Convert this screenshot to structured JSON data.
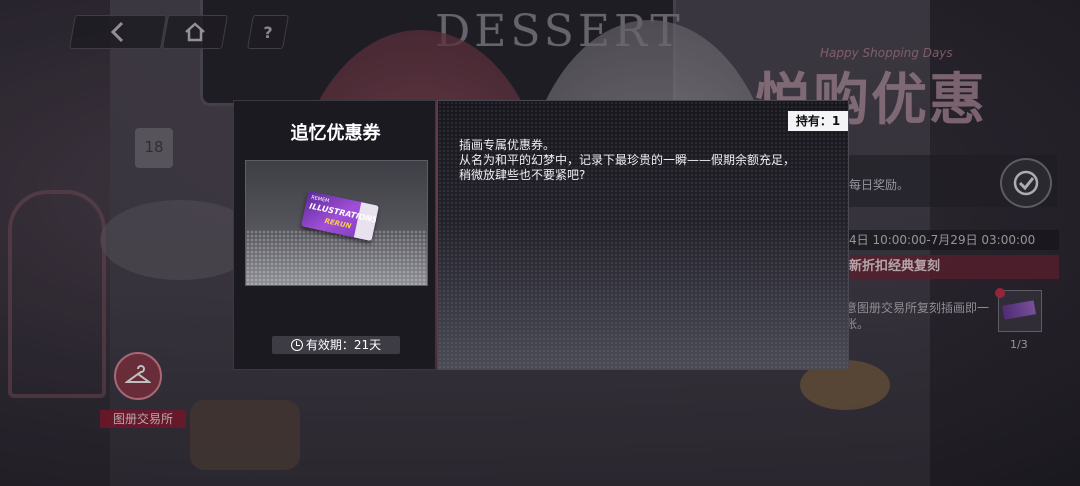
{
  "nav": {
    "back_icon": "back-arrow-icon",
    "home_icon": "home-icon",
    "help_icon": "question-icon"
  },
  "background": {
    "sign_text": "DESSERT",
    "clock_number": "18"
  },
  "event": {
    "subtitle": "Happy Shopping Days",
    "title": "悦购优惠",
    "daily_reward": "每日奖励。",
    "time_range": "4日 10:00:00-7月29日 03:00:00",
    "banner": "新折扣经典复刻",
    "desc": "意图册交易所复刻插画即一张。",
    "count": "1/3"
  },
  "shop": {
    "label": "图册交易所"
  },
  "item_dialog": {
    "title": "追忆优惠券",
    "owned": "持有：1",
    "expiry": "有效期：21天",
    "description_lines": [
      "插画专属优惠券。",
      "从名为和平的幻梦中，记录下最珍贵的一瞬——假期余额充足，",
      "稍微放肆些也不要紧吧?"
    ],
    "ticket_text": {
      "small": "REMEM",
      "main": "ILLUSTRATIONS",
      "tag": "RERUN"
    }
  },
  "colors": {
    "dialog_bg": "#1b1a21",
    "owned_badge": "#f4f4f6",
    "ticket": "#a14fd6",
    "banner": "#78283c"
  }
}
